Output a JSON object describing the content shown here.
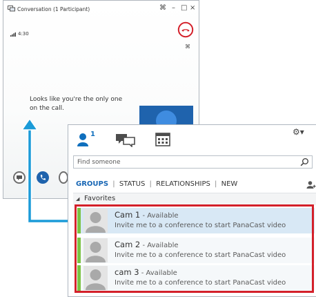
{
  "conversation": {
    "title": "Conversation (1 Participant)",
    "controls": {
      "pin": "⌘",
      "minimize": "–",
      "maximize": "□",
      "close": "×"
    },
    "call_time": "4:30",
    "pin_label": "⌘",
    "message": "Looks like you're the only one on the call."
  },
  "contacts": {
    "contacts_tab_count": "1",
    "gear_label": "⚙▾",
    "search": {
      "placeholder": "Find someone",
      "value": ""
    },
    "filters": {
      "groups": "GROUPS",
      "status": "STATUS",
      "relationships": "RELATIONSHIPS",
      "new": "NEW",
      "separator": "|"
    },
    "favorites_header": "Favorites",
    "favorites_toggle": "◢",
    "items": [
      {
        "name": "Cam 1",
        "status": " - Available",
        "note": "Invite me to a conference to start PanaCast video"
      },
      {
        "name": "Cam 2",
        "status": " - Available",
        "note": "Invite me to a conference to start PanaCast video"
      },
      {
        "name": "cam 3",
        "status": " - Available",
        "note": "Invite me to a conference to start PanaCast video"
      }
    ]
  },
  "colors": {
    "accent_blue": "#1766b4",
    "presence_available": "#7bc242",
    "hangup_red": "#d4202a",
    "highlight_box": "#d4202a",
    "arrow_blue": "#1b9bd8"
  }
}
